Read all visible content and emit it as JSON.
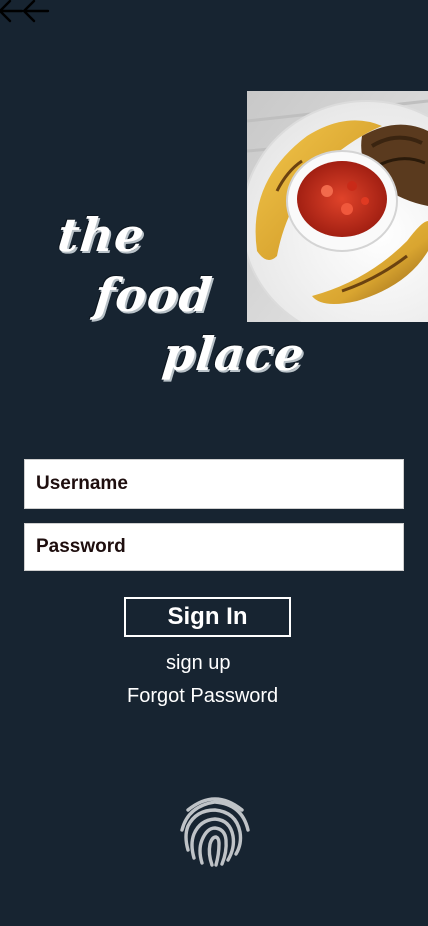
{
  "header": {
    "back_icon": "double-left-arrow-icon"
  },
  "hero": {
    "description_icon": "food-photo"
  },
  "brand": {
    "word1": "the",
    "word2": "food",
    "word3": "place"
  },
  "form": {
    "username_placeholder": "Username",
    "password_placeholder": "Password",
    "signin_label": "Sign In",
    "signup_label": "sign up",
    "forgot_label": "Forgot Password",
    "fingerprint_icon": "fingerprint-icon"
  },
  "colors": {
    "background": "#172431",
    "text": "#ffffff",
    "field_bg": "#ffffff"
  }
}
